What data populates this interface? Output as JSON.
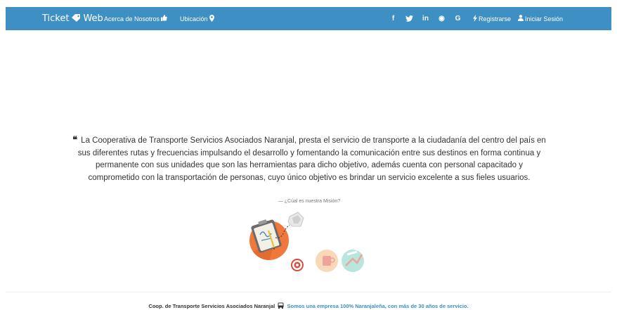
{
  "navbar": {
    "brand_left": "Ticket",
    "brand_right": "Web",
    "links": [
      {
        "label": "Acerca de Nosotros",
        "icon": "thumbs-up-icon"
      },
      {
        "label": "Ubicación",
        "icon": "map-marker-icon"
      }
    ],
    "social": [
      {
        "glyph": "f",
        "icon": "facebook-icon"
      },
      {
        "glyph": "",
        "icon": "twitter-icon"
      },
      {
        "glyph": "in",
        "icon": "linkedin-icon"
      },
      {
        "glyph": "◉",
        "icon": "pinterest-icon"
      },
      {
        "glyph": "G",
        "icon": "google-icon"
      }
    ],
    "register_label": "Registrarse",
    "login_label": "Iniciar Sesión",
    "bg_color": "#3d8fc4"
  },
  "mission": {
    "quote": "La Cooperativa de Transporte Servicios Asociados Naranjal, presta el servicio de transporte a la ciudadanía del centro del país en sus diferentes rutas y frecuencias impulsando el desarrollo y fomentando la comunicación entre sus destinos en forma continua y permanente con sus unidades que son las herramientas para dicho objetivo, además cuenta con personal capacitado y comprometido con la transportación de personas, cuyo único objetivo es brindar un servicio excelente a sus fieles usuarios.",
    "caption": "— ¿Cúal es nuestra Misión?"
  },
  "footer": {
    "company": "Coop. de Transporte Servicios Asociados Naranjal",
    "slogan": "Somos una empresa 100% Naranjaleña, con más de 30 años de servicio.",
    "accent_color": "#3d8fc4"
  }
}
